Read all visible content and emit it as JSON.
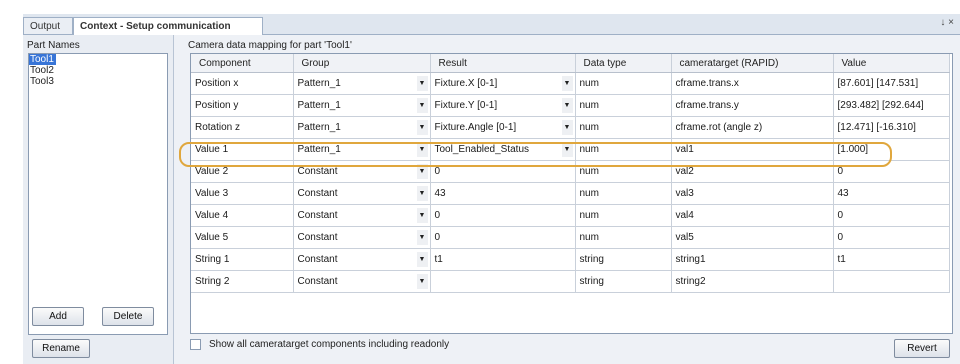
{
  "tabs": {
    "output": "Output",
    "context": "Context - Setup communication",
    "tools": "↓ ×"
  },
  "parts": {
    "title": "Part Names",
    "items": [
      "Tool1",
      "Tool2",
      "Tool3"
    ],
    "add": "Add",
    "delete": "Delete",
    "rename": "Rename"
  },
  "mapping": {
    "title": "Camera data mapping for part 'Tool1'",
    "headers": [
      "Component",
      "Group",
      "Result",
      "Data type",
      "cameratarget (RAPID)",
      "Value"
    ],
    "rows": [
      {
        "component": "Position x",
        "group": "Pattern_1",
        "result": "Fixture.X [0-1]",
        "datatype": "num",
        "target": "cframe.trans.x",
        "value": "[87.601] [147.531]"
      },
      {
        "component": "Position y",
        "group": "Pattern_1",
        "result": "Fixture.Y [0-1]",
        "datatype": "num",
        "target": "cframe.trans.y",
        "value": "[293.482] [292.644]"
      },
      {
        "component": "Rotation z",
        "group": "Pattern_1",
        "result": "Fixture.Angle [0-1]",
        "datatype": "num",
        "target": "cframe.rot (angle z)",
        "value": "[12.471] [-16.310]"
      },
      {
        "component": "Value 1",
        "group": "Pattern_1",
        "result": "Tool_Enabled_Status",
        "datatype": "num",
        "target": "val1",
        "value": "[1.000]"
      },
      {
        "component": "Value 2",
        "group": "Constant",
        "result": "0",
        "datatype": "num",
        "target": "val2",
        "value": "0"
      },
      {
        "component": "Value 3",
        "group": "Constant",
        "result": "43",
        "datatype": "num",
        "target": "val3",
        "value": "43"
      },
      {
        "component": "Value 4",
        "group": "Constant",
        "result": "0",
        "datatype": "num",
        "target": "val4",
        "value": "0"
      },
      {
        "component": "Value 5",
        "group": "Constant",
        "result": "0",
        "datatype": "num",
        "target": "val5",
        "value": "0"
      },
      {
        "component": "String 1",
        "group": "Constant",
        "result": "t1",
        "datatype": "string",
        "target": "string1",
        "value": "t1"
      },
      {
        "component": "String 2",
        "group": "Constant",
        "result": "",
        "datatype": "string",
        "target": "string2",
        "value": ""
      }
    ],
    "show_all": "Show all cameratarget components including readonly",
    "revert": "Revert"
  },
  "colors": {
    "highlight": "#e0a73d",
    "selection": "#3875d7"
  }
}
